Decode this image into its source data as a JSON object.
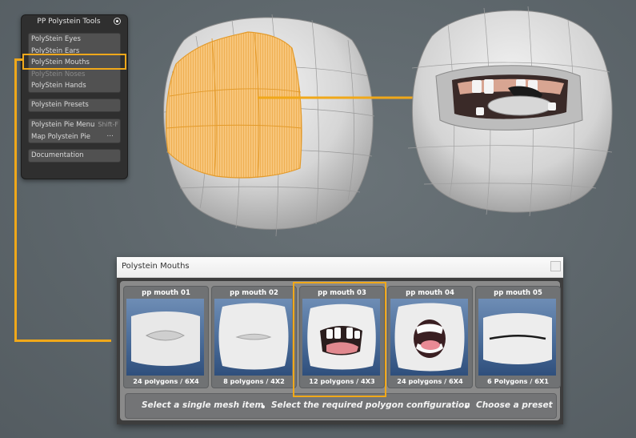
{
  "tools_panel": {
    "title": "PP Polystein Tools",
    "group1": [
      {
        "label": "PolyStein Eyes"
      },
      {
        "label": "PolyStein Ears"
      },
      {
        "label": "PolyStein Mouths"
      },
      {
        "label": "PolyStein Noses",
        "disabled": true
      },
      {
        "label": "PolyStein Hands"
      }
    ],
    "presets_label": "Polystein Presets",
    "pie_menu_label": "Polystein Pie Menu",
    "pie_menu_shortcut": "Shift-F",
    "map_pie_label": "Map Polystein Pie",
    "map_pie_dots": "...",
    "documentation_label": "Documentation"
  },
  "mouths_window": {
    "title": "Polystein Mouths",
    "cards": [
      {
        "title": "pp mouth 01",
        "footer": "24 polygons / 6X4"
      },
      {
        "title": "pp mouth 02",
        "footer": "8 polygons / 4X2"
      },
      {
        "title": "pp mouth 03",
        "footer": "12 polygons / 4X3"
      },
      {
        "title": "pp mouth 04",
        "footer": "24 polygons / 6X4"
      },
      {
        "title": "pp mouth 05",
        "footer": "6 Polygons / 6X1"
      }
    ],
    "selected_card": "pp mouth 03",
    "instructions": [
      "Select a single mesh item",
      "Select the required  polygon configuration",
      "Choose a preset"
    ]
  },
  "colors": {
    "accent": "#f0a81a",
    "background": "#5d666b",
    "panel": "#2f2f2f",
    "thumb_blue": "#4a6c99"
  }
}
